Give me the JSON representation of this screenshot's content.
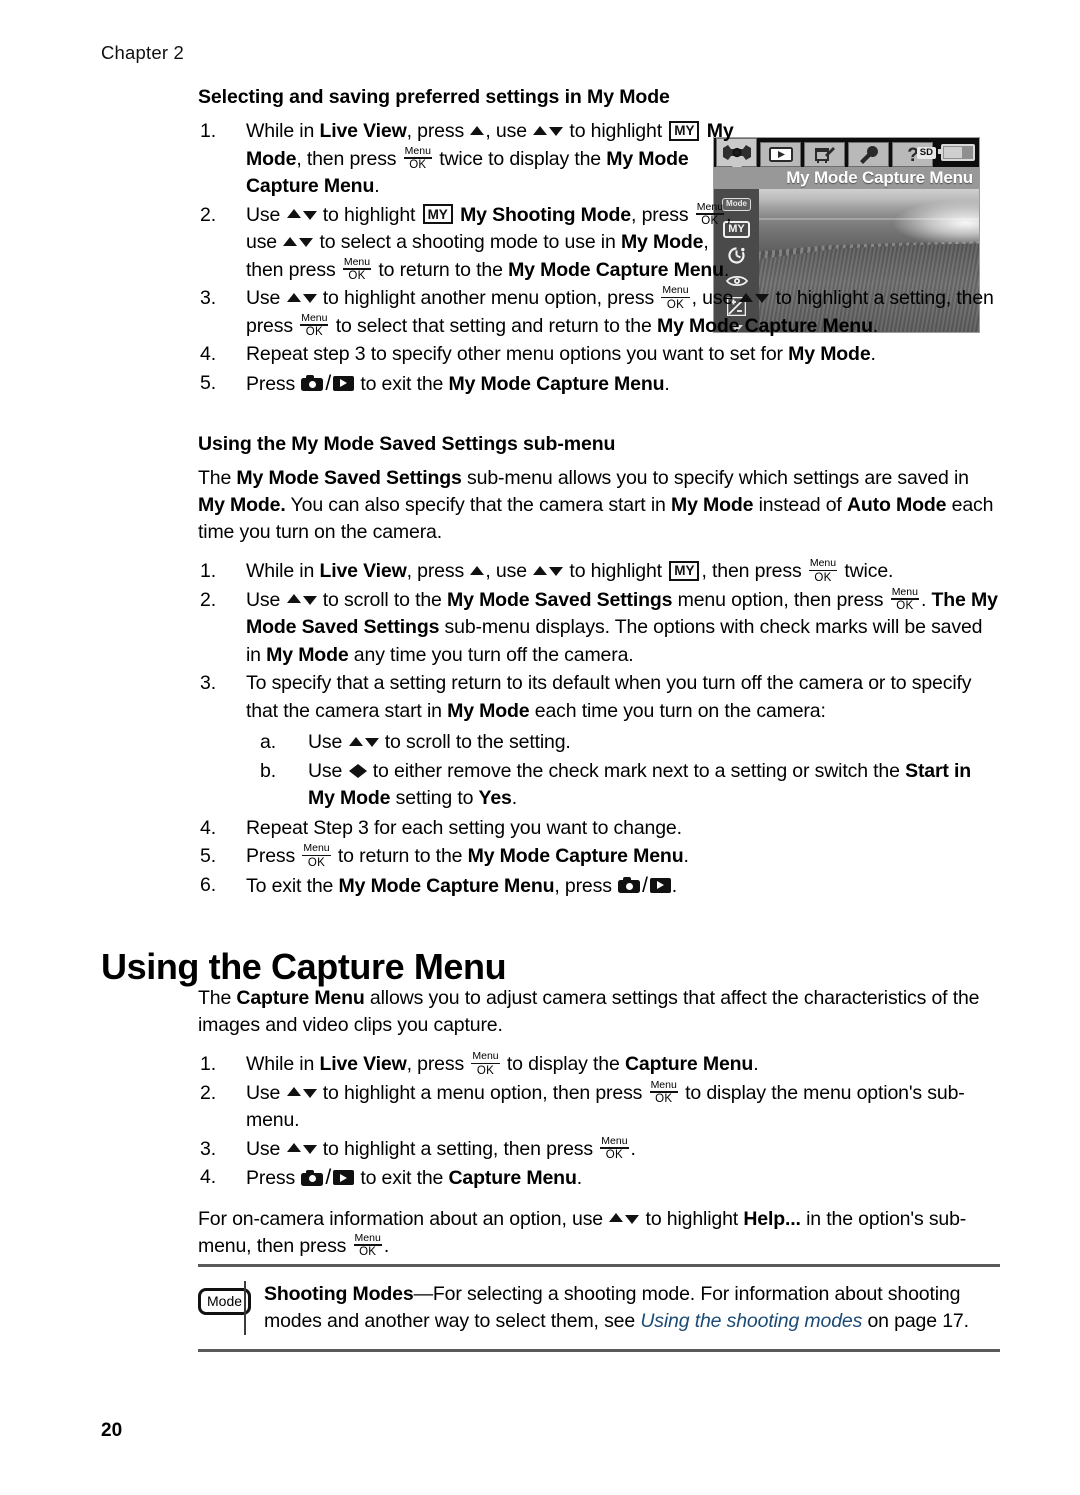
{
  "chapter_label": "Chapter 2",
  "folio": "20",
  "section1": {
    "heading": "Selecting and saving preferred settings in My Mode",
    "steps": [
      {
        "num": "1."
      },
      {
        "num": "2."
      },
      {
        "num": "3."
      },
      {
        "num": "4."
      },
      {
        "num": "5."
      }
    ],
    "step1": {
      "a": "While in ",
      "b_live_view": "Live View",
      "c": ", press ",
      "d": ", use ",
      "e": " to",
      "f": "highlight ",
      "my_badge": "MY",
      "g": " My Mode",
      "h": ", then press ",
      "i": " twice to",
      "j": "display the ",
      "k_bold": "My Mode Capture Menu",
      "l": "."
    },
    "step2": {
      "a": "Use ",
      "b": " to highlight ",
      "my_badge": "MY",
      "c_bold": " My Shooting Mode",
      "d": ",",
      "e": "press ",
      "f": ", use ",
      "g": " to select a shooting mode to",
      "h": "use in ",
      "i_bold": "My Mode",
      "j": ", then press ",
      "k": " to return to the",
      "l_bold": "My Mode Capture Menu",
      "m": "."
    },
    "step3": {
      "a": "Use ",
      "b": " to highlight another menu option, press",
      "c": ", use ",
      "d": " to highlight a setting, then press",
      "e": " to select that setting and return to the ",
      "f_bold": "My Mode Capture Menu",
      "g": "."
    },
    "step4": {
      "a": "Repeat step 3 to specify other menu options you want to set for ",
      "b_bold": "My Mode",
      "c": "."
    },
    "step5": {
      "a": "Press ",
      "b": " to exit the ",
      "c_bold": "My Mode Capture Menu",
      "d": "."
    }
  },
  "section2": {
    "heading": "Using the My Mode Saved Settings sub-menu",
    "intro": {
      "a": "The ",
      "b_bold": "My Mode Saved Settings",
      "c": " sub-menu allows you to specify which settings are saved in ",
      "d_bold": "My Mode.",
      "e": " You can also specify that the camera start in ",
      "f_bold": "My Mode",
      "g": " instead of ",
      "h_bold": "Auto Mode",
      "i": " each time you turn on the camera."
    },
    "step1": {
      "a": "While in ",
      "b_bold": "Live View",
      "c": ", press ",
      "d": ", use ",
      "e": " to highlight ",
      "my_badge": "MY",
      "f": ", then press ",
      "g": " twice."
    },
    "step2": {
      "a": "Use ",
      "b": " to scroll to the ",
      "c_bold": "My Mode Saved Settings",
      "d": " menu option, then press ",
      "e": ".",
      "f_bold": "The My Mode Saved Settings",
      "g": " sub-menu displays. The options with check marks will be saved in ",
      "h_bold": "My Mode",
      "i": " any time you turn off the camera."
    },
    "step3": {
      "a": "To specify that a setting return to its default when you turn off the camera or to specify that the camera start in ",
      "b_bold": "My Mode",
      "c": " each time you turn on the camera:"
    },
    "step3a": {
      "a": "Use ",
      "b": " to scroll to the setting."
    },
    "step3b": {
      "a": "Use ",
      "b": " to either remove the check mark next to a setting or switch the ",
      "c_bold": "Start in My Mode",
      "d": " setting to ",
      "e_bold": "Yes",
      "f": "."
    },
    "step4": {
      "a": "Repeat Step 3 for each setting you want to change."
    },
    "step5": {
      "a": "Press ",
      "b": " to return to the ",
      "c_bold": "My Mode Capture Menu",
      "d": "."
    },
    "step6": {
      "a": "To exit the ",
      "b_bold": "My Mode Capture Menu",
      "c": ", press ",
      "d": "."
    },
    "nums": [
      "1.",
      "2.",
      "3.",
      "4.",
      "5.",
      "6."
    ],
    "alpha_nums": [
      "a.",
      "b."
    ]
  },
  "section3": {
    "heading": "Using the Capture Menu",
    "intro": {
      "a": "The ",
      "b_bold": "Capture Menu",
      "c": " allows you to adjust camera settings that affect the characteristics of the images and video clips you capture."
    },
    "step1": {
      "a": "While in ",
      "b_bold": "Live View",
      "c": ", press ",
      "d": " to display the ",
      "e_bold": "Capture Menu",
      "f": "."
    },
    "step2": {
      "a": "Use ",
      "b": " to highlight a menu option, then press ",
      "c": " to display the menu option's sub-menu."
    },
    "step3": {
      "a": "Use ",
      "b": " to highlight a setting, then press ",
      "c": "."
    },
    "step4": {
      "a": "Press ",
      "b": " to exit the ",
      "c_bold": "Capture Menu",
      "d": "."
    },
    "nums": [
      "1.",
      "2.",
      "3.",
      "4."
    ],
    "outro": {
      "a": "For on-camera information about an option, use ",
      "b": " to highlight ",
      "c_bold": "Help...",
      "d": " in the option's sub-menu, then press ",
      "e": "."
    }
  },
  "note": {
    "icon_label": "Mode",
    "title": "Shooting Modes",
    "body_a": "—For selecting a shooting mode. For information about shooting modes and another way to select them, see ",
    "link": "Using the shooting modes",
    "body_b": " on page 17."
  },
  "menu_ok_key": {
    "top": "Menu",
    "bottom": "OK"
  },
  "lcd": {
    "title": "My Mode Capture Menu",
    "sd_label": "SD",
    "tabs": [
      {
        "name": "capture-tab"
      },
      {
        "name": "playback-tab"
      },
      {
        "name": "design-gallery-tab"
      },
      {
        "name": "setup-tab"
      },
      {
        "name": "help-tab"
      }
    ],
    "side_icons": [
      {
        "label": "Mode",
        "name": "shooting-modes-icon"
      },
      {
        "label": "MY",
        "name": "my-mode-icon"
      },
      {
        "label": "",
        "name": "self-timer-icon"
      },
      {
        "label": "",
        "name": "red-eye-icon"
      },
      {
        "label": "",
        "name": "exposure-compensation-icon"
      },
      {
        "label": "",
        "name": "scroll-down-caret-icon"
      }
    ]
  },
  "colors": {
    "link": "#1b4a76",
    "rule": "#5a5a5a",
    "lcd_bg": "#8e8e8e"
  }
}
